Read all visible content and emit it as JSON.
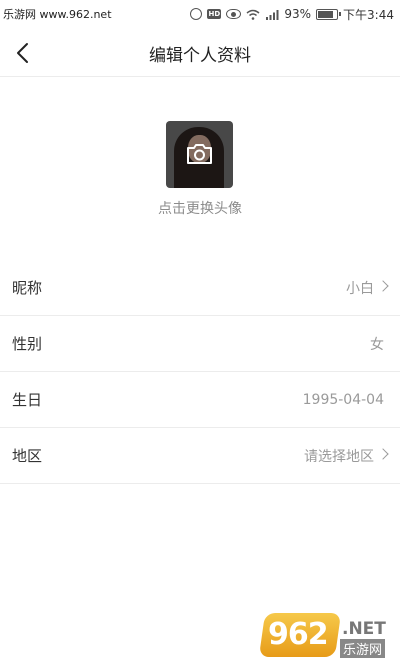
{
  "status_bar": {
    "site": "乐游网 www.962.net",
    "battery": "93%",
    "battery_level": 0.93,
    "time": "下午3:44",
    "hd_badge": "HD",
    "icons": [
      "alarm-icon",
      "hd-icon",
      "eye-icon",
      "wifi-icon",
      "signal-icon",
      "battery-icon"
    ]
  },
  "nav": {
    "title": "编辑个人资料",
    "back_icon": "chevron-left-icon"
  },
  "avatar": {
    "change_label": "点击更换头像",
    "camera_icon": "camera-icon"
  },
  "form": {
    "rows": [
      {
        "label": "昵称",
        "value": "小白",
        "arrow": true
      },
      {
        "label": "性别",
        "value": "女",
        "arrow": false
      },
      {
        "label": "生日",
        "value": "1995-04-04",
        "arrow": false
      },
      {
        "label": "地区",
        "value": "请选择地区",
        "arrow": true
      }
    ]
  },
  "watermark": {
    "number": "962",
    "domain": ".NET",
    "cn": "乐游网"
  }
}
